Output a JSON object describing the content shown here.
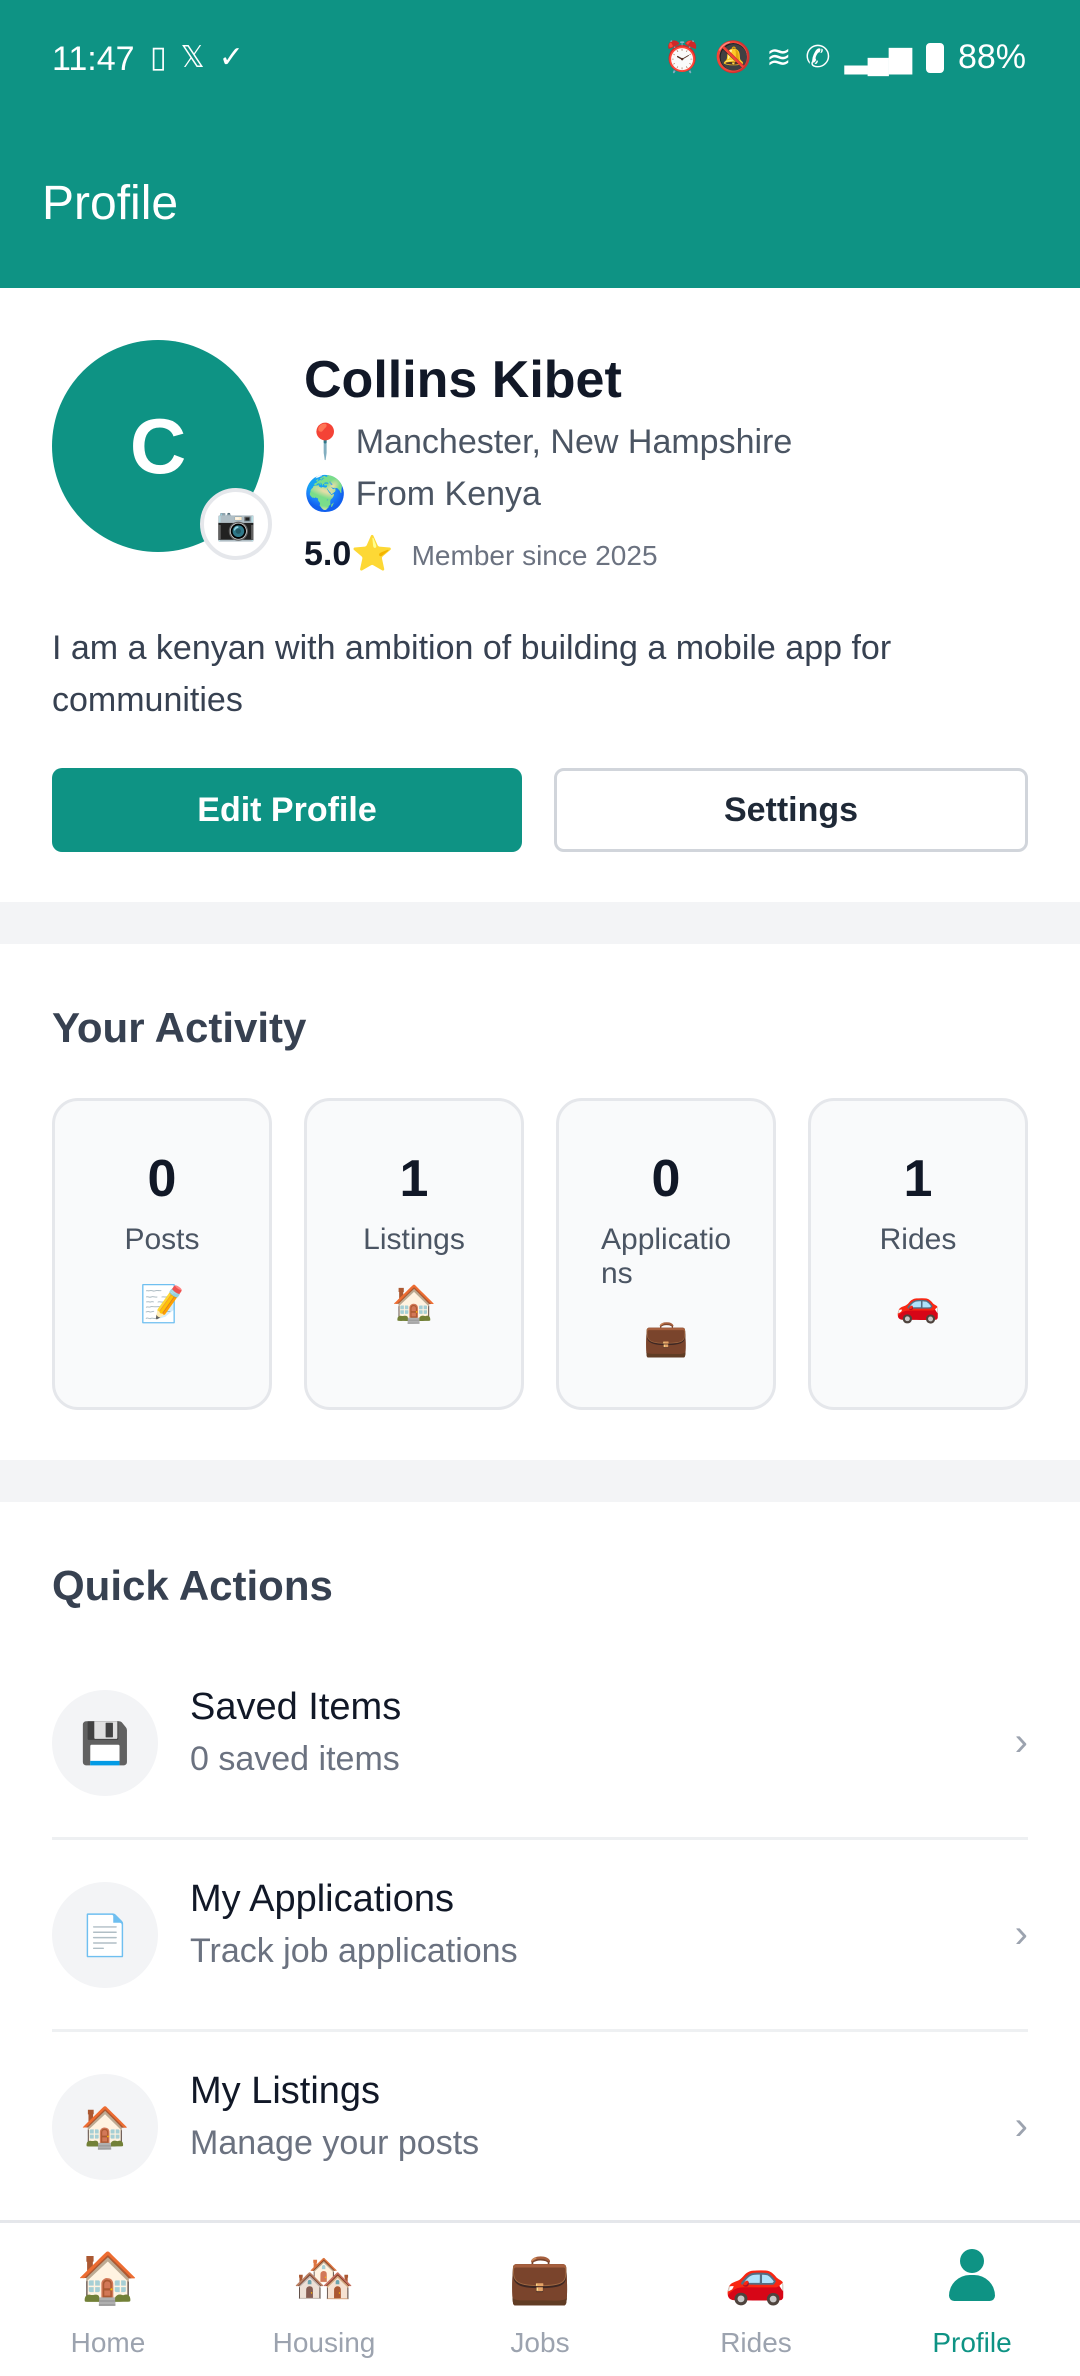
{
  "status_bar": {
    "time": "11:47",
    "battery": "88%"
  },
  "header": {
    "title": "Profile",
    "bg_color": "#0e9384"
  },
  "profile": {
    "initial": "C",
    "name": "Collins Kibet",
    "location": "📍 Manchester, New Hampshire",
    "origin": "🌍 From Kenya",
    "rating": "5.0⭐",
    "member_since": "Member since 2025",
    "bio": "I am a kenyan with ambition of building a mobile app for communities",
    "edit_label": "Edit Profile",
    "settings_label": "Settings"
  },
  "activity": {
    "title": "Your Activity",
    "cards": [
      {
        "count": "0",
        "label": "Posts",
        "icon": "📝"
      },
      {
        "count": "1",
        "label": "Listings",
        "icon": "🏠"
      },
      {
        "count": "0",
        "label": "Applications",
        "icon": "💼"
      },
      {
        "count": "1",
        "label": "Rides",
        "icon": "🚗"
      }
    ]
  },
  "quick_actions": {
    "title": "Quick Actions",
    "items": [
      {
        "title": "Saved Items",
        "subtitle": "0 saved items",
        "icon": "💾"
      },
      {
        "title": "My Applications",
        "subtitle": "Track job applications",
        "icon": "📄"
      },
      {
        "title": "My Listings",
        "subtitle": "Manage your posts",
        "icon": "🏠"
      }
    ]
  },
  "bottom_nav": [
    {
      "label": "Home",
      "icon": "🏠"
    },
    {
      "label": "Housing",
      "icon": "🏘️"
    },
    {
      "label": "Jobs",
      "icon": "💼"
    },
    {
      "label": "Rides",
      "icon": "🚗"
    },
    {
      "label": "Profile",
      "icon": "person-icon",
      "active": true
    }
  ]
}
